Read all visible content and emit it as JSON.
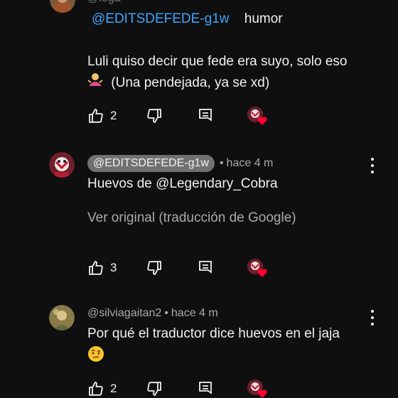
{
  "reply1": {
    "mention": "@EDITSDEFEDE-g1w",
    "text_after_mention": "humor",
    "body_line1": "Luli quiso decir que fede era suyo, solo eso",
    "body_line2": "(Una pendejada, ya se xd)",
    "like_count": "2"
  },
  "reply2": {
    "author": "@EDITSDEFEDE-g1w",
    "separator": "•",
    "time": "hace 4 m",
    "body_prefix": "Huevos de ",
    "body_mention": "@Legendary_Cobra",
    "translate_link": "Ver original (traducción de Google)",
    "like_count": "3"
  },
  "reply3": {
    "author": "@silviagaitan2",
    "separator": "•",
    "time": "hace 4 m",
    "body_line1": "Por qué el traductor dice huevos en el jaja",
    "like_count": "2"
  },
  "icons": {
    "like": "thumbs-up-icon",
    "dislike": "thumbs-down-icon",
    "reply": "reply-comment-icon",
    "creator_heart": "creator-heart-badge",
    "menu": "more-vert-icon"
  },
  "colors": {
    "background": "#0f0f0f",
    "mention": "#3ea6ff",
    "secondary_text": "#aaaaaa",
    "chip_bg": "#717171",
    "heart": "#ff0033"
  }
}
